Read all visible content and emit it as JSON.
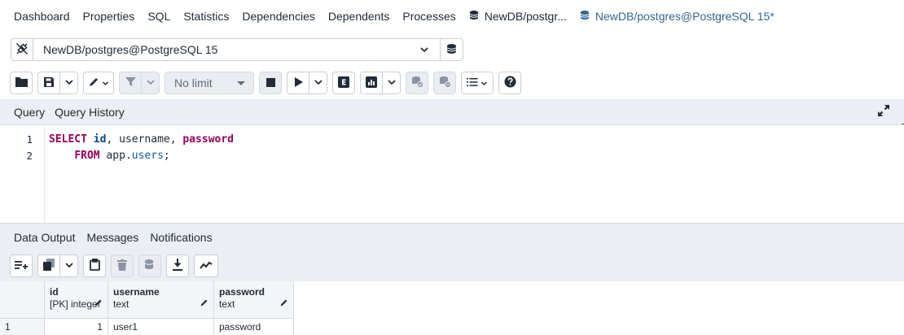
{
  "tabs": [
    {
      "label": "Dashboard"
    },
    {
      "label": "Properties"
    },
    {
      "label": "SQL"
    },
    {
      "label": "Statistics"
    },
    {
      "label": "Dependencies"
    },
    {
      "label": "Dependents"
    },
    {
      "label": "Processes"
    },
    {
      "label": "NewDB/postgr..."
    },
    {
      "label": "NewDB/postgres@PostgreSQL 15*"
    }
  ],
  "connection": {
    "value": "NewDB/postgres@PostgreSQL 15"
  },
  "toolbar": {
    "limit": "No limit"
  },
  "query_tabs": [
    "Query",
    "Query History"
  ],
  "editor": {
    "lines": [
      "1",
      "2"
    ],
    "l1": {
      "kw_select": "SELECT",
      "c1": "id",
      "sep1": ", ",
      "c2": "username",
      "sep2": ", ",
      "c3": "password"
    },
    "l2": {
      "indent": "    ",
      "kw_from": "FROM",
      "schema": " app.",
      "table": "users",
      "end": ";"
    }
  },
  "result_tabs": [
    "Data Output",
    "Messages",
    "Notifications"
  ],
  "grid": {
    "columns": [
      {
        "name": "id",
        "type": "[PK] integer"
      },
      {
        "name": "username",
        "type": "text"
      },
      {
        "name": "password",
        "type": "text"
      }
    ],
    "rows": [
      {
        "num": "1",
        "cells": [
          "1",
          "user1",
          "password"
        ]
      }
    ]
  },
  "colors": {
    "accent": "#326690",
    "panel": "#ebeef3",
    "keyword": "#990055"
  }
}
